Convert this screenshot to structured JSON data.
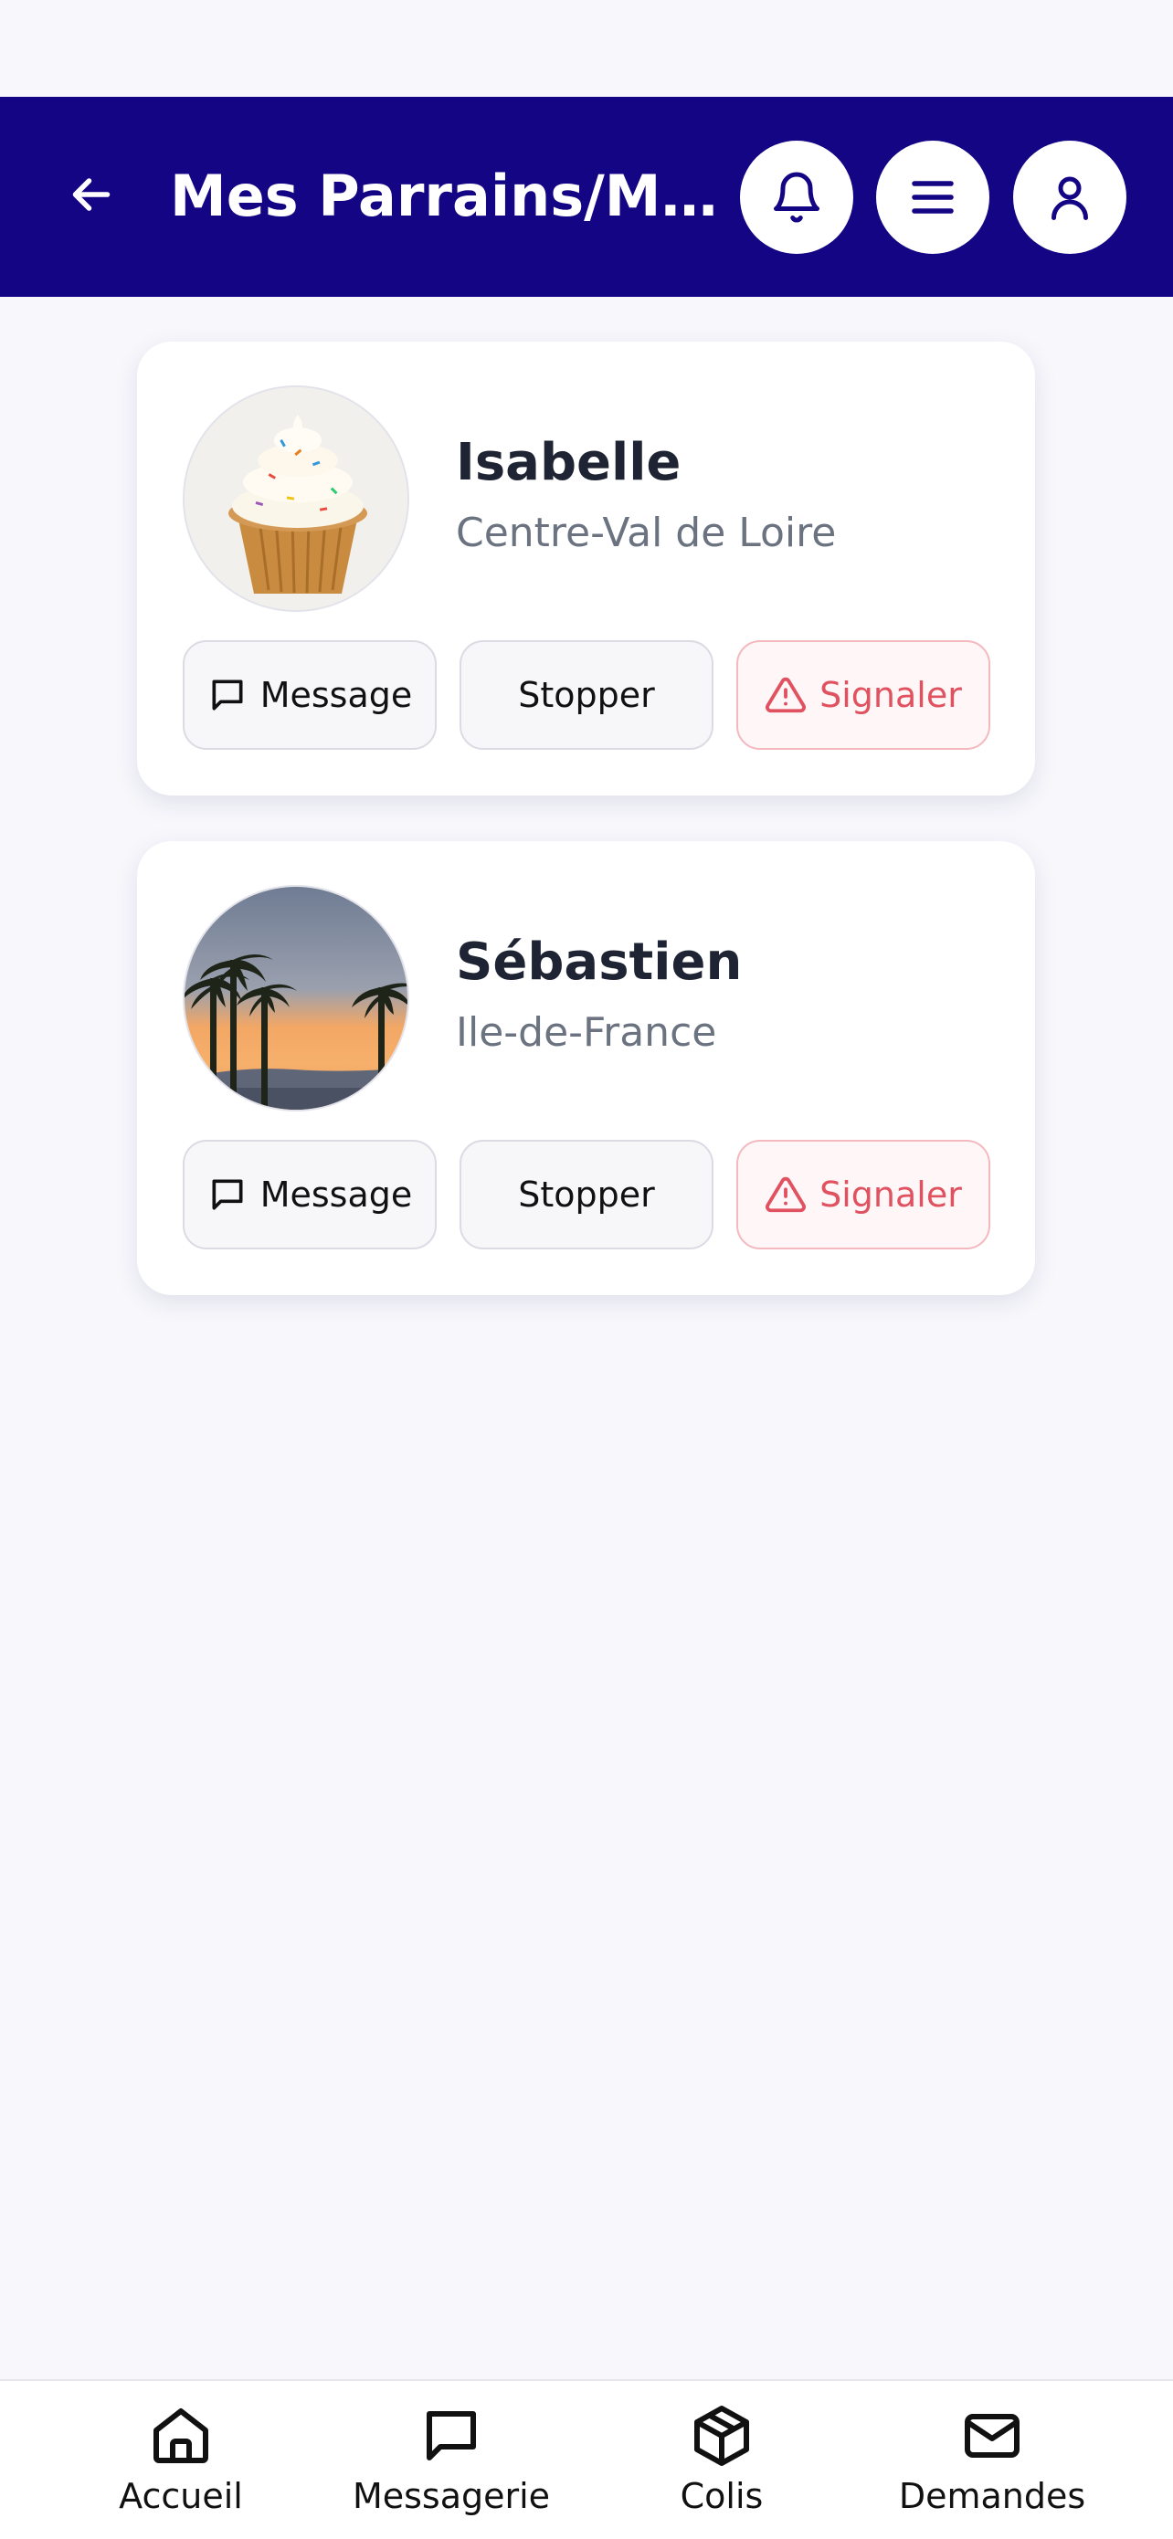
{
  "header": {
    "title": "Mes Parrains/Marr...",
    "background": "#140585",
    "icons": [
      "arrow-left-icon",
      "bell-icon",
      "menu-icon",
      "user-icon"
    ]
  },
  "sponsors": [
    {
      "name": "Isabelle",
      "region": "Centre-Val de Loire",
      "avatar": "cupcake-image"
    },
    {
      "name": "Sébastien",
      "region": "Ile-de-France",
      "avatar": "palm-trees-sunset-image"
    }
  ],
  "actions": {
    "message": "Message",
    "stop": "Stopper",
    "report": "Signaler"
  },
  "colors": {
    "report": "#E05260",
    "text": "#1E2433",
    "muted": "#6B7280"
  },
  "tabbar": {
    "items": [
      {
        "label": "Accueil",
        "icon": "home-icon"
      },
      {
        "label": "Messagerie",
        "icon": "chat-icon"
      },
      {
        "label": "Colis",
        "icon": "package-icon"
      },
      {
        "label": "Demandes",
        "icon": "mail-icon"
      }
    ]
  }
}
